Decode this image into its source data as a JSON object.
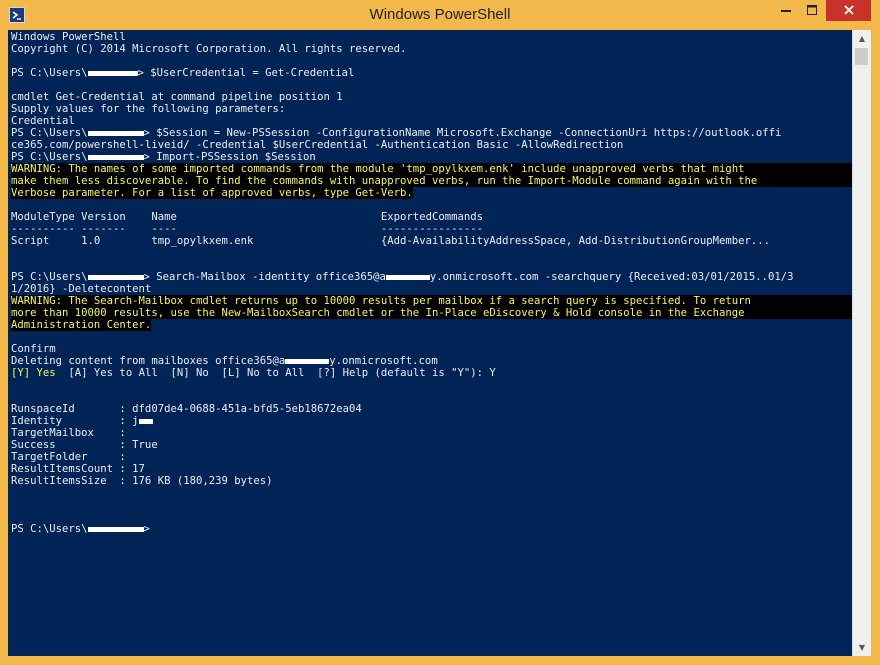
{
  "window": {
    "title": "Windows PowerShell",
    "accent": "#f2b84a",
    "console_bg": "#012456",
    "warning_fg": "#f5f56b"
  },
  "controls": {
    "minimize_icon": "minimize-icon",
    "maximize_icon": "maximize-icon",
    "close_icon": "close-icon"
  },
  "console": {
    "banner1": "Windows PowerShell",
    "banner2": "Copyright (C) 2014 Microsoft Corporation. All rights reserved.",
    "ps_prefix": "PS C:\\Users\\",
    "cmd1": "> $UserCredential = Get-Credential",
    "cred1": "cmdlet Get-Credential at command pipeline position 1",
    "cred2": "Supply values for the following parameters:",
    "cred3": "Credential",
    "cmd2": "> $Session = New-PSSession -ConfigurationName Microsoft.Exchange -ConnectionUri https://outlook.offi",
    "cmd2_cont": "ce365.com/powershell-liveid/ -Credential $UserCredential -Authentication Basic -AllowRedirection",
    "cmd3": "> Import-PSSession $Session",
    "warn1_l1": "WARNING: The names of some imported commands from the module 'tmp_opylkxem.enk' include unapproved verbs that might",
    "warn1_l2": "make them less discoverable. To find the commands with unapproved verbs, run the Import-Module command again with the",
    "warn1_l3": "Verbose parameter. For a list of approved verbs, type Get-Verb.",
    "table_header": "ModuleType Version    Name                                ExportedCommands",
    "table_sep": "---------- -------    ----                                ----------------",
    "table_row": "Script     1.0        tmp_opylkxem.enk                    {Add-AvailabilityAddressSpace, Add-DistributionGroupMember...",
    "cmd4_a": "> Search-Mailbox -identity office365@a",
    "cmd4_b": "y.onmicrosoft.com -searchquery {Received:03/01/2015..01/3",
    "cmd4_cont": "1/2016} -Deletecontent",
    "warn2_l1": "WARNING: The Search-Mailbox cmdlet returns up to 10000 results per mailbox if a search query is specified. To return",
    "warn2_l2": "more than 10000 results, use the New-MailboxSearch cmdlet or the In-Place eDiscovery & Hold console in the Exchange",
    "warn2_l3": "Administration Center.",
    "confirm": "Confirm",
    "deleting_a": "Deleting content from mailboxes office365@a",
    "deleting_b": "y.onmicrosoft.com",
    "prompt_y": "[Y] Yes",
    "prompt_rest": "  [A] Yes to All  [N] No  [L] No to All  [?] Help (default is \"Y\"): Y",
    "r_runspace": "RunspaceId       : dfd07de4-0688-451a-bfd5-5eb18672ea04",
    "r_identity": "Identity         : j",
    "r_targetmailbox": "TargetMailbox    :",
    "r_success": "Success          : True",
    "r_targetfolder": "TargetFolder     :",
    "r_count": "ResultItemsCount : 17",
    "r_size": "ResultItemsSize  : 176 KB (180,239 bytes)",
    "prompt_end": ">"
  }
}
